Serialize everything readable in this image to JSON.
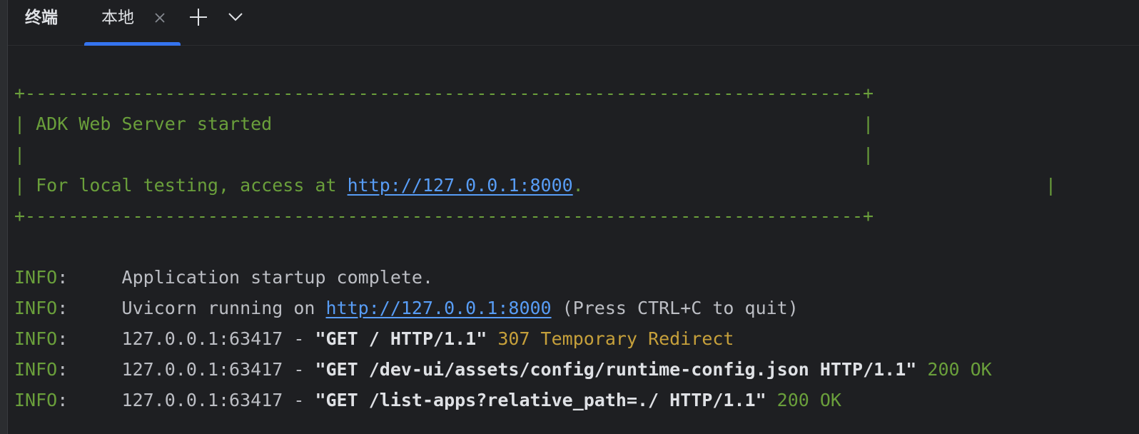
{
  "tabs": {
    "tool_title": "终端",
    "active_tab": "本地",
    "add_tab_label": "+",
    "dropdown_label": "⌄"
  },
  "colors": {
    "background": "#1e1f22",
    "accent": "#3574f0",
    "banner_green": "#6a9f3b",
    "link_blue": "#589df6",
    "redirect_yellow": "#c6a03b"
  },
  "banner": {
    "border_top": "+------------------------------------------------------------------------------+",
    "title_line": "| ADK Web Server started                                                       |",
    "empty_line": "|                                                                              |",
    "access_prefix": "| For local testing, access at ",
    "access_url": "http://127.0.0.1:8000",
    "access_suffix": ".                                           |",
    "border_bottom": "+------------------------------------------------------------------------------+"
  },
  "log": [
    {
      "level": "INFO",
      "sep": ":     ",
      "text": "Application startup complete."
    },
    {
      "level": "INFO",
      "sep": ":     ",
      "prefix": "Uvicorn running on ",
      "url": "http://127.0.0.1:8000",
      "suffix": " (Press CTRL+C to quit)"
    },
    {
      "level": "INFO",
      "sep": ":     ",
      "addr": "127.0.0.1:63417 - ",
      "request": "\"GET / HTTP/1.1\"",
      "status": " 307 Temporary Redirect"
    },
    {
      "level": "INFO",
      "sep": ":     ",
      "addr": "127.0.0.1:63417 - ",
      "request": "\"GET /dev-ui/assets/config/runtime-config.json HTTP/1.1\"",
      "status": " 200 OK"
    },
    {
      "level": "INFO",
      "sep": ":     ",
      "addr": "127.0.0.1:63417 - ",
      "request": "\"GET /list-apps?relative_path=./ HTTP/1.1\"",
      "status": " 200 OK"
    }
  ]
}
